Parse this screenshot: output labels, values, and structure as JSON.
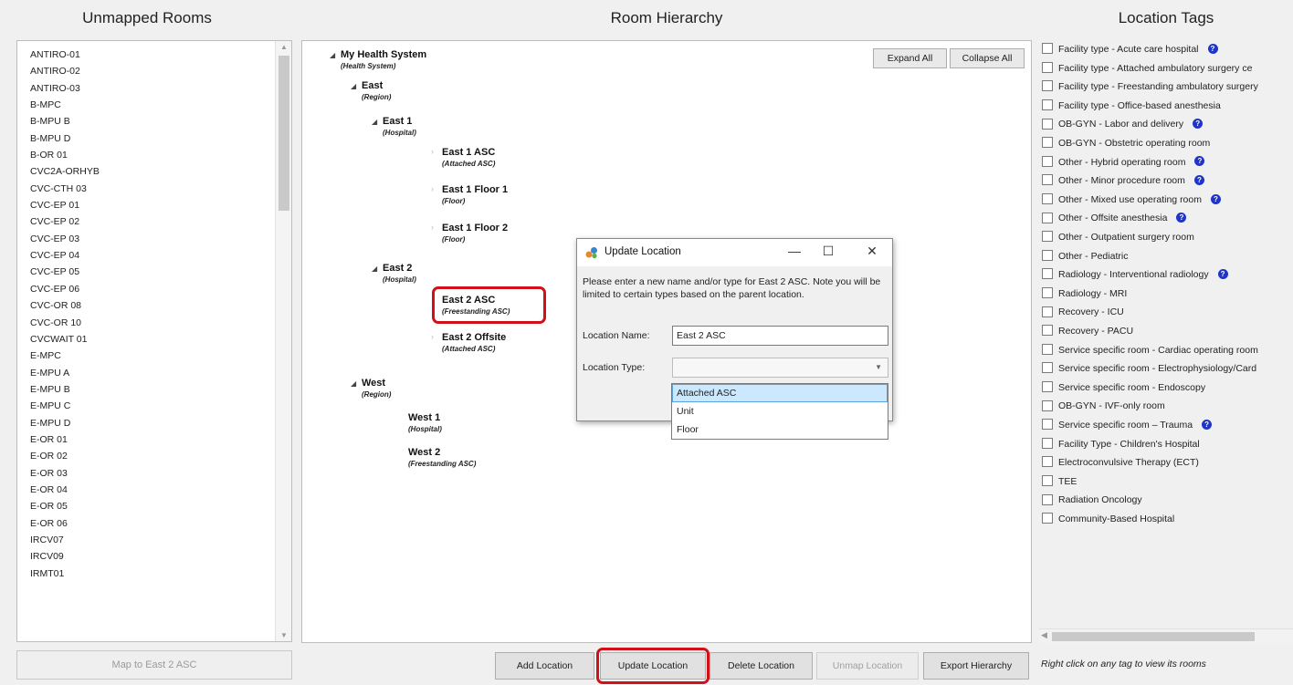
{
  "unmapped": {
    "title": "Unmapped Rooms",
    "rooms": [
      "ANTIRO-01",
      "ANTIRO-02",
      "ANTIRO-03",
      "B-MPC",
      "B-MPU B",
      "B-MPU D",
      "B-OR 01",
      "CVC2A-ORHYB",
      "CVC-CTH 03",
      "CVC-EP 01",
      "CVC-EP 02",
      "CVC-EP 03",
      "CVC-EP 04",
      "CVC-EP 05",
      "CVC-EP 06",
      "CVC-OR 08",
      "CVC-OR 10",
      "CVCWAIT 01",
      "E-MPC",
      "E-MPU A",
      "E-MPU B",
      "E-MPU C",
      "E-MPU D",
      "E-OR 01",
      "E-OR 02",
      "E-OR 03",
      "E-OR 04",
      "E-OR 05",
      "E-OR 06",
      "IRCV07",
      "IRCV09",
      "IRMT01"
    ],
    "map_button": "Map to East 2 ASC"
  },
  "hierarchy": {
    "title": "Room Hierarchy",
    "expand_all": "Expand All",
    "collapse_all": "Collapse All",
    "nodes": [
      {
        "name": "My Health System",
        "type": "(Health System)"
      },
      {
        "name": "East",
        "type": "(Region)"
      },
      {
        "name": "East 1",
        "type": "(Hospital)"
      },
      {
        "name": "East 1 ASC",
        "type": "(Attached ASC)"
      },
      {
        "name": "East 1 Floor 1",
        "type": "(Floor)"
      },
      {
        "name": "East 1 Floor 2",
        "type": "(Floor)"
      },
      {
        "name": "East 2",
        "type": "(Hospital)"
      },
      {
        "name": "East 2 ASC",
        "type": "(Freestanding ASC)"
      },
      {
        "name": "East 2 Offsite",
        "type": "(Attached ASC)"
      },
      {
        "name": "West",
        "type": "(Region)"
      },
      {
        "name": "West 1",
        "type": "(Hospital)"
      },
      {
        "name": "West 2",
        "type": "(Freestanding ASC)"
      }
    ],
    "buttons": {
      "add": "Add Location",
      "update": "Update Location",
      "delete": "Delete Location",
      "unmap": "Unmap Location",
      "export": "Export Hierarchy"
    }
  },
  "tags": {
    "title": "Location Tags",
    "items": [
      {
        "label": "Facility type - Acute care hospital",
        "info": true
      },
      {
        "label": "Facility type - Attached ambulatory surgery ce",
        "info": false
      },
      {
        "label": "Facility type - Freestanding ambulatory surgery",
        "info": false
      },
      {
        "label": "Facility type - Office-based anesthesia",
        "info": false
      },
      {
        "label": "OB-GYN - Labor and delivery",
        "info": true
      },
      {
        "label": "OB-GYN - Obstetric operating room",
        "info": false
      },
      {
        "label": "Other - Hybrid operating room",
        "info": true
      },
      {
        "label": "Other - Minor procedure room",
        "info": true
      },
      {
        "label": "Other - Mixed use operating room",
        "info": true
      },
      {
        "label": "Other - Offsite anesthesia",
        "info": true
      },
      {
        "label": "Other - Outpatient surgery room",
        "info": false
      },
      {
        "label": "Other - Pediatric",
        "info": false
      },
      {
        "label": "Radiology - Interventional radiology",
        "info": true
      },
      {
        "label": "Radiology - MRI",
        "info": false
      },
      {
        "label": "Recovery - ICU",
        "info": false
      },
      {
        "label": "Recovery - PACU",
        "info": false
      },
      {
        "label": "Service specific room - Cardiac operating room",
        "info": false
      },
      {
        "label": "Service specific room - Electrophysiology/Card",
        "info": false
      },
      {
        "label": "Service specific room - Endoscopy",
        "info": false
      },
      {
        "label": "OB-GYN - IVF-only room",
        "info": false
      },
      {
        "label": "Service specific room – Trauma",
        "info": true
      },
      {
        "label": "Facility Type - Children's Hospital",
        "info": false
      },
      {
        "label": "Electroconvulsive Therapy (ECT)",
        "info": false
      },
      {
        "label": "TEE",
        "info": false
      },
      {
        "label": "Radiation Oncology",
        "info": false
      },
      {
        "label": "Community-Based Hospital",
        "info": false
      }
    ],
    "info_glyph": "?",
    "hint": "Right click on any tag to view its rooms"
  },
  "dialog": {
    "title": "Update Location",
    "minimize": "—",
    "maximize": "☐",
    "close": "✕",
    "message": "Please enter a new name and/or type for East 2 ASC. Note you will be limited to certain types based on the parent location.",
    "name_label": "Location Name:",
    "name_value": "East 2 ASC",
    "type_label": "Location Type:",
    "type_options": [
      "Attached ASC",
      "Unit",
      "Floor"
    ],
    "selected_option": "Attached ASC"
  },
  "colors": {
    "highlight": "#d0101a",
    "info_icon": "#1f35c8",
    "dropdown_selected": "#cce8ff"
  }
}
